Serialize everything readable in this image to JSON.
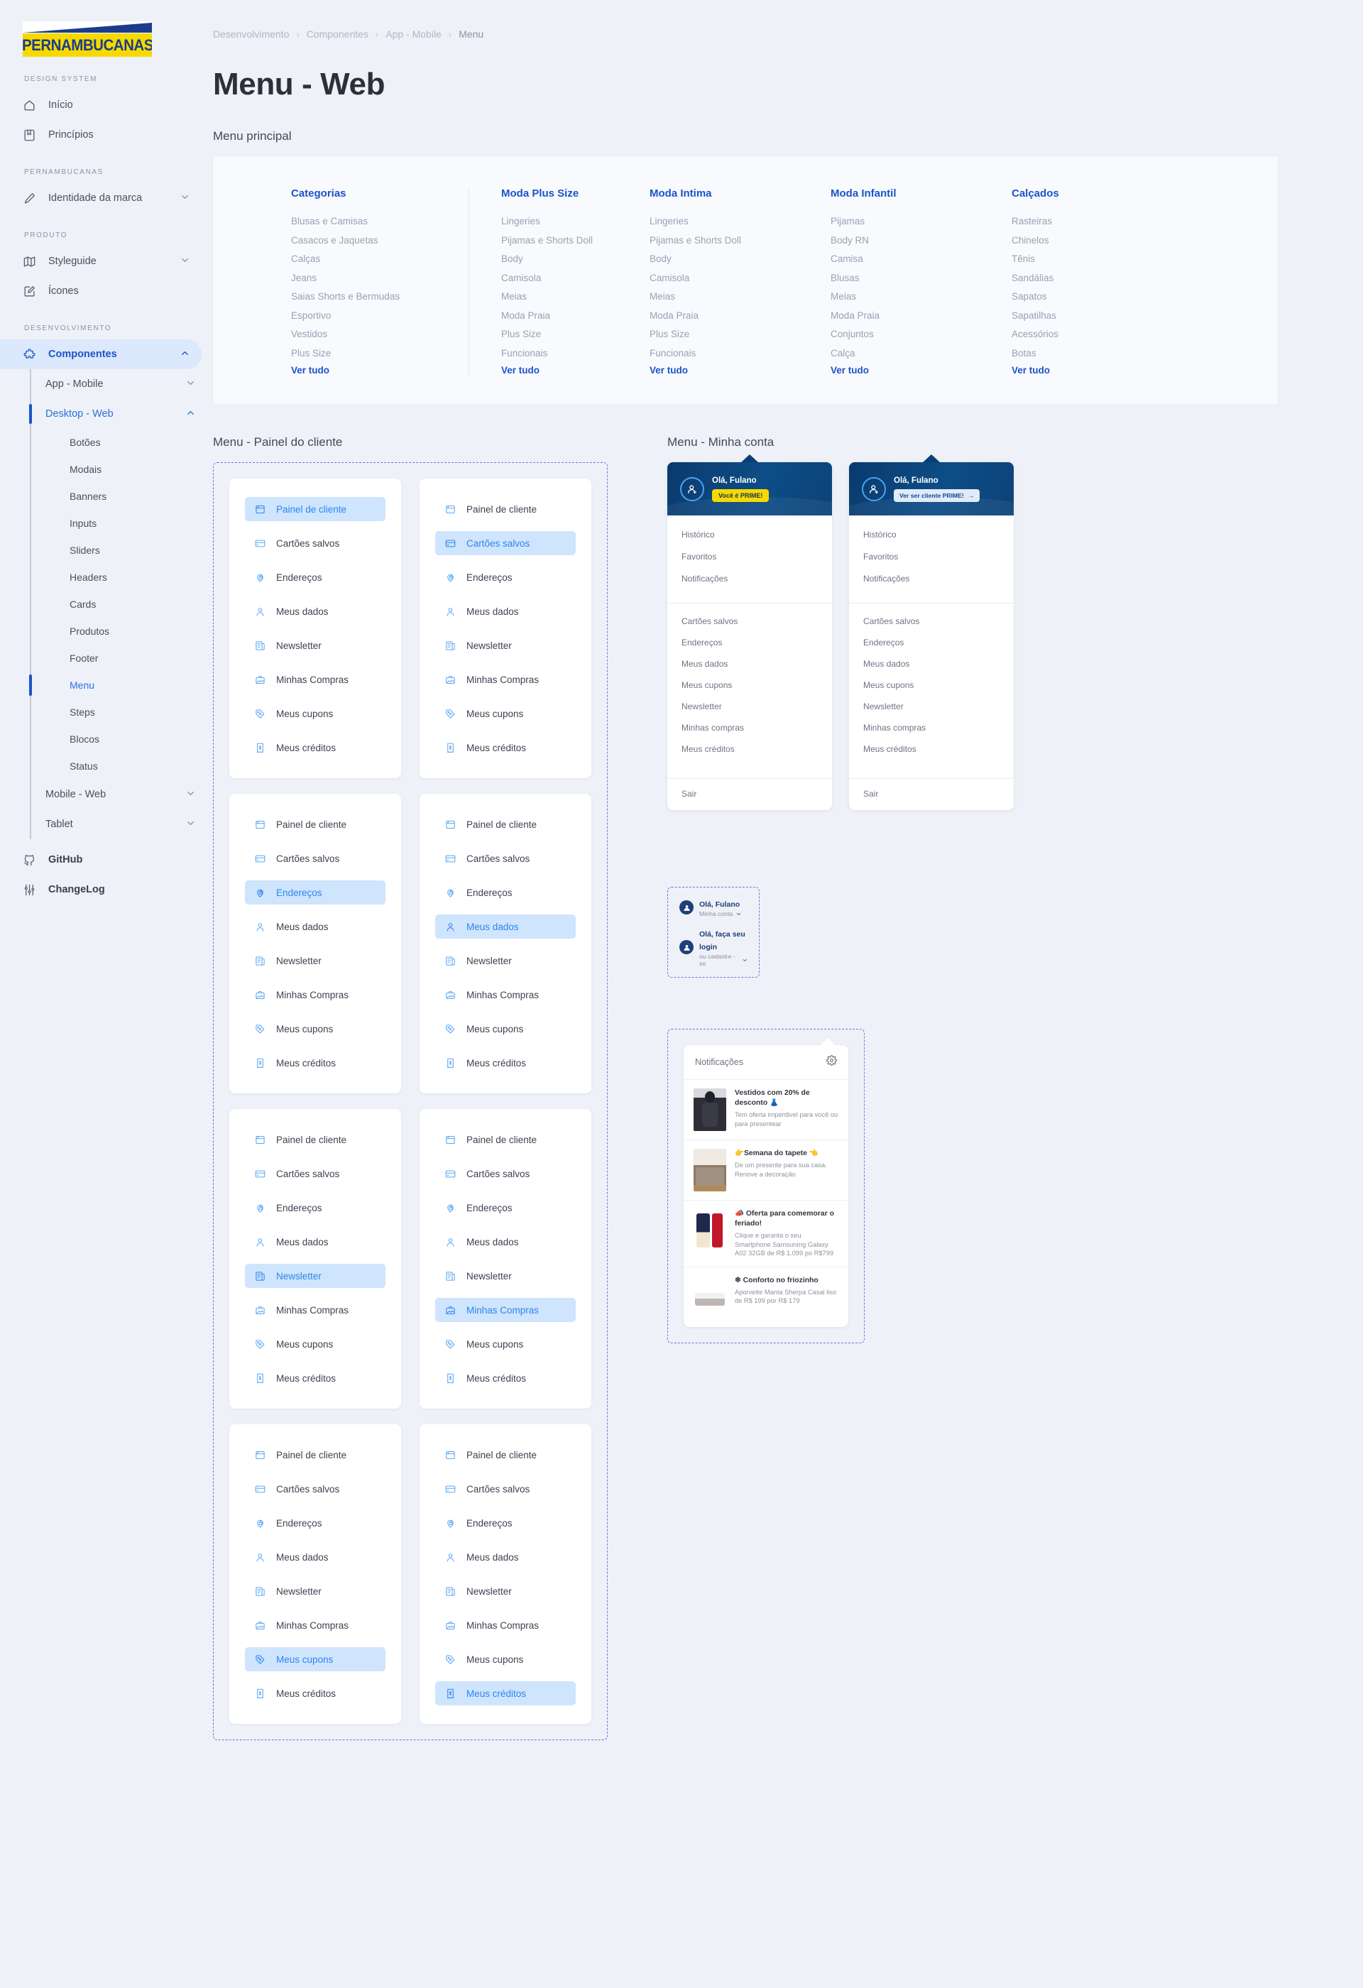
{
  "brand": {
    "logo_text": "PERNAMBUCANAS",
    "colors": {
      "yellow": "#f5d900",
      "navy": "#1b3c8c",
      "accent": "#1c53c7",
      "highlight_bg": "#cfe4fd",
      "highlight_text": "#2b86f0"
    }
  },
  "sidebar": {
    "sections": [
      {
        "label": "DESIGN SYSTEM",
        "items": [
          {
            "label": "Início",
            "icon": "home-icon"
          },
          {
            "label": "Princípios",
            "icon": "book-icon"
          }
        ]
      },
      {
        "label": "PERNAMBUCANAS",
        "items": [
          {
            "label": "Identidade da marca",
            "icon": "pen-icon",
            "chevron": "down"
          }
        ]
      },
      {
        "label": "PRODUTO",
        "items": [
          {
            "label": "Styleguide",
            "icon": "map-icon",
            "chevron": "down"
          },
          {
            "label": "Ícones",
            "icon": "edit-square-icon"
          }
        ]
      },
      {
        "label": "DESENVOLVIMENTO",
        "items": [
          {
            "label": "Componentes",
            "icon": "puzzle-icon",
            "chevron": "up",
            "active": true
          }
        ]
      }
    ],
    "componentes_children": [
      {
        "label": "App - Mobile",
        "chevron": "down"
      },
      {
        "label": "Desktop - Web",
        "chevron": "up",
        "open": true
      }
    ],
    "desktop_web_leaves": [
      "Botões",
      "Modais",
      "Banners",
      "Inputs",
      "Sliders",
      "Headers",
      "Cards",
      "Produtos",
      "Footer",
      "Menu",
      "Steps",
      "Blocos",
      "Status"
    ],
    "selected_leaf": "Menu",
    "after_leaves": [
      {
        "label": "Mobile - Web",
        "chevron": "down"
      },
      {
        "label": "Tablet",
        "chevron": "down"
      }
    ],
    "footer_items": [
      {
        "label": "GitHub",
        "icon": "github-icon"
      },
      {
        "label": "ChangeLog",
        "icon": "sliders-icon"
      }
    ]
  },
  "breadcrumb": [
    "Desenvolvimento",
    "Componentes",
    "App - Mobile",
    "Menu"
  ],
  "page_title": "Menu - Web",
  "sections": {
    "menu_principal": "Menu principal",
    "painel_cliente": "Menu - Painel do cliente",
    "minha_conta": "Menu - Minha conta"
  },
  "menu_principal_columns": [
    {
      "title": "Categorias",
      "items": [
        "Blusas e Camisas",
        "Casacos e Jaquetas",
        "Calças",
        "Jeans",
        "Saias Shorts e Bermudas",
        "Esportivo",
        "Vestidos",
        "Plus Size"
      ],
      "more": "Ver tudo"
    },
    {
      "title": "Moda Plus Size",
      "items": [
        "Lingeries",
        "Pijamas e Shorts Doll",
        "Body",
        "Camisola",
        "Meias",
        "Moda Praia",
        "Plus Size",
        "Funcionais"
      ],
      "more": "Ver tudo"
    },
    {
      "title": "Moda Intima",
      "items": [
        "Lingeries",
        "Pijamas e Shorts Doll",
        "Body",
        "Camisola",
        "Meias",
        "Moda Praia",
        "Plus Size",
        "Funcionais"
      ],
      "more": "Ver tudo"
    },
    {
      "title": "Moda Infantil",
      "items": [
        "Pijamas",
        "Body RN",
        "Camisa",
        "Blusas",
        "Meias",
        "Moda Praia",
        "Conjuntos",
        "Calça"
      ],
      "more": "Ver tudo"
    },
    {
      "title": "Calçados",
      "items": [
        "Rasteiras",
        "Chinelos",
        "Tênis",
        "Sandálias",
        "Sapatos",
        "Sapatilhas",
        "Acessórios",
        "Botas"
      ],
      "more": "Ver tudo"
    }
  ],
  "panel_items": [
    {
      "label": "Painel de cliente",
      "icon": "window-icon"
    },
    {
      "label": "Cartões salvos",
      "icon": "credit-card-icon"
    },
    {
      "label": "Endereços",
      "icon": "map-pin-lock-icon"
    },
    {
      "label": "Meus dados",
      "icon": "user-icon"
    },
    {
      "label": "Newsletter",
      "icon": "newspaper-icon"
    },
    {
      "label": "Minhas Compras",
      "icon": "bag-icon"
    },
    {
      "label": "Meus cupons",
      "icon": "tag-icon"
    },
    {
      "label": "Meus créditos",
      "icon": "receipt-icon"
    }
  ],
  "panel_cards_highlight": [
    "Painel de cliente",
    "Cartões salvos",
    "Endereços",
    "Meus dados",
    "Newsletter",
    "Minhas Compras",
    "Meus cupons",
    "Meus créditos"
  ],
  "account": {
    "cards": [
      {
        "greeting": "Olá, Fulano",
        "badge": "Você é PRIME!",
        "badge_style": "yellow",
        "group_a": [
          "Histórico",
          "Favoritos",
          "Notificações"
        ],
        "group_b": [
          "Cartões salvos",
          "Endereços",
          "Meus dados",
          "Meus cupons",
          "Newsletter",
          "Minhas compras",
          "Meus créditos"
        ],
        "logout": "Sair"
      },
      {
        "greeting": "Olá, Fulano",
        "badge": "Ver ser cliente PRIME!",
        "badge_style": "outline",
        "group_a": [
          "Histórico",
          "Favoritos",
          "Notificações"
        ],
        "group_b": [
          "Cartões salvos",
          "Endereços",
          "Meus dados",
          "Meus cupons",
          "Newsletter",
          "Minhas compras",
          "Meus créditos"
        ],
        "logout": "Sair"
      }
    ]
  },
  "login_widget": {
    "rows": [
      {
        "title": "Olá, Fulano",
        "sub": "Minha conta"
      },
      {
        "title": "Olá, faça seu login",
        "sub": "ou cadastre -se"
      }
    ]
  },
  "notifications": {
    "title": "Notificações",
    "settings_icon": "gear-icon",
    "items": [
      {
        "title": "Vestidos com 20% de desconto 👗",
        "desc": "Tem oferta imperdivel para você ou para presentear",
        "thumb": "th-dress"
      },
      {
        "title": "👉Semana do tapete 👈",
        "desc": "De um presente para sua casa. Renove a decoração",
        "thumb": "th-rug"
      },
      {
        "title": "📣 Oferta para comemorar o feriado!",
        "desc": "Clique e garanta o seu Smartphone Samsunmg Galaxy A02 32GB de R$ 1.099 po R$799",
        "thumb": "th-phone"
      },
      {
        "title": "❄ Conforto no friozinho",
        "desc": "Aporveite Manta Sherpa Casal liso de R$ 199 por R$ 179",
        "thumb": "th-blanket"
      }
    ]
  }
}
